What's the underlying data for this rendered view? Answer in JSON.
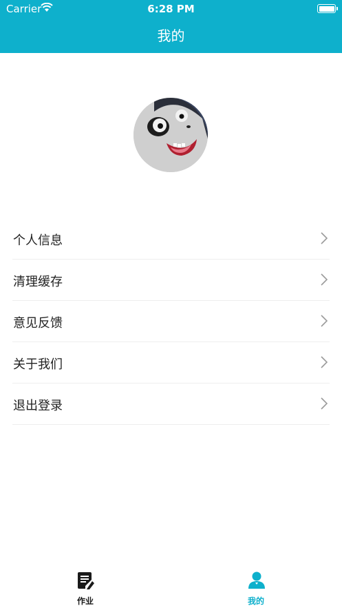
{
  "status_bar": {
    "carrier": "Carrier",
    "time": "6:28 PM"
  },
  "header": {
    "title": "我的"
  },
  "menu": {
    "items": [
      {
        "label": "个人信息"
      },
      {
        "label": "清理缓存"
      },
      {
        "label": "意见反馈"
      },
      {
        "label": "关于我们"
      },
      {
        "label": "退出登录"
      }
    ]
  },
  "tabbar": {
    "tabs": [
      {
        "label": "作业",
        "icon": "document-edit-icon",
        "active": false
      },
      {
        "label": "我的",
        "icon": "user-icon",
        "active": true
      }
    ]
  },
  "colors": {
    "accent": "#0eb0cc",
    "inactive_tab": "#1a1a1a"
  }
}
